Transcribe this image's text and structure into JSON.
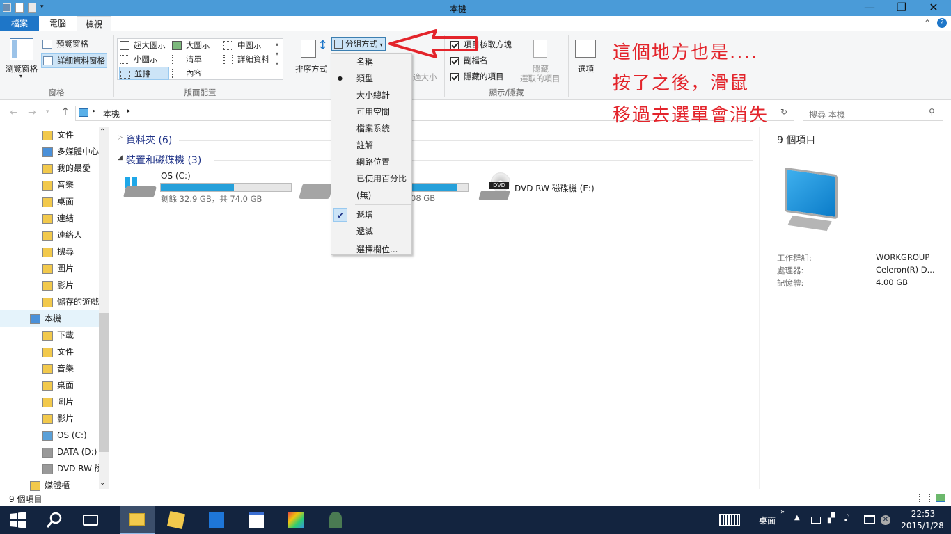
{
  "window": {
    "title": "本機"
  },
  "tabs": [
    "檔案",
    "電腦",
    "檢視"
  ],
  "ribbon": {
    "pane_large": "瀏覽窗格",
    "preview_pane": "預覽窗格",
    "details_pane": "詳細資料窗格",
    "group_panes": "窗格",
    "layouts": [
      "超大圖示",
      "大圖示",
      "中圖示",
      "小圖示",
      "清單",
      "詳細資料",
      "並排",
      "內容"
    ],
    "group_layout": "版面配置",
    "sort_by": "排序方式",
    "group_by": "分組方式",
    "size_cols_partial": "適大小",
    "item_checkboxes_partial": "項目核取方塊",
    "file_extensions": "副檔名",
    "hidden_items": "隱藏的項目",
    "hide_selected_line1": "隱藏",
    "hide_selected_line2": "選取的項目",
    "group_showhide": "顯示/隱藏",
    "options": "選項"
  },
  "groupby_menu": {
    "items": [
      "名稱",
      "類型",
      "大小總計",
      "可用空間",
      "檔案系統",
      "註解",
      "網路位置",
      "已使用百分比",
      "(無)"
    ],
    "selected": "類型",
    "order": [
      "遞增",
      "遞減"
    ],
    "order_selected": "遞增",
    "choose_columns": "選擇欄位..."
  },
  "address": {
    "path": "本機",
    "search_placeholder": "搜尋 本機"
  },
  "nav": {
    "items": [
      {
        "label": "文件",
        "indent": 1
      },
      {
        "label": "多媒體中心",
        "indent": 1
      },
      {
        "label": "我的最愛",
        "indent": 1
      },
      {
        "label": "音樂",
        "indent": 1
      },
      {
        "label": "桌面",
        "indent": 1
      },
      {
        "label": "連結",
        "indent": 1
      },
      {
        "label": "連絡人",
        "indent": 1
      },
      {
        "label": "搜尋",
        "indent": 1
      },
      {
        "label": "圖片",
        "indent": 1
      },
      {
        "label": "影片",
        "indent": 1
      },
      {
        "label": "儲存的遊戲",
        "indent": 1
      },
      {
        "label": "本機",
        "indent": 0
      },
      {
        "label": "下載",
        "indent": 1
      },
      {
        "label": "文件",
        "indent": 1
      },
      {
        "label": "音樂",
        "indent": 1
      },
      {
        "label": "桌面",
        "indent": 1
      },
      {
        "label": "圖片",
        "indent": 1
      },
      {
        "label": "影片",
        "indent": 1
      },
      {
        "label": "OS (C:)",
        "indent": 1
      },
      {
        "label": "DATA (D:)",
        "indent": 1
      },
      {
        "label": "DVD RW 磁",
        "indent": 1
      },
      {
        "label": "媒體櫃",
        "indent": 0
      }
    ]
  },
  "content": {
    "group_folders": "資料夾 (6)",
    "group_devices": "裝置和磁碟機 (3)",
    "drives": [
      {
        "name": "OS (C:)",
        "free_text": "剩餘 32.9 GB，共 74.0 GB",
        "used_fraction": 0.56
      },
      {
        "name": "",
        "free_text": "08 GB",
        "used_fraction": 0.92
      },
      {
        "name": "DVD RW 磁碟機 (E:)"
      }
    ]
  },
  "details": {
    "count": "9 個項目",
    "rows": [
      {
        "k": "工作群組:",
        "v": "WORKGROUP"
      },
      {
        "k": "處理器:",
        "v": "Celeron(R) D..."
      },
      {
        "k": "記憶體:",
        "v": "4.00 GB"
      }
    ]
  },
  "status": {
    "count": "9 個項目"
  },
  "annotation": {
    "lines": [
      "這個地方也是....",
      "按了之後，滑鼠",
      "移過去選單會消失"
    ],
    "color": "#e3242b"
  },
  "taskbar": {
    "tray_desktop": "桌面",
    "time": "22:53",
    "date": "2015/1/28"
  }
}
